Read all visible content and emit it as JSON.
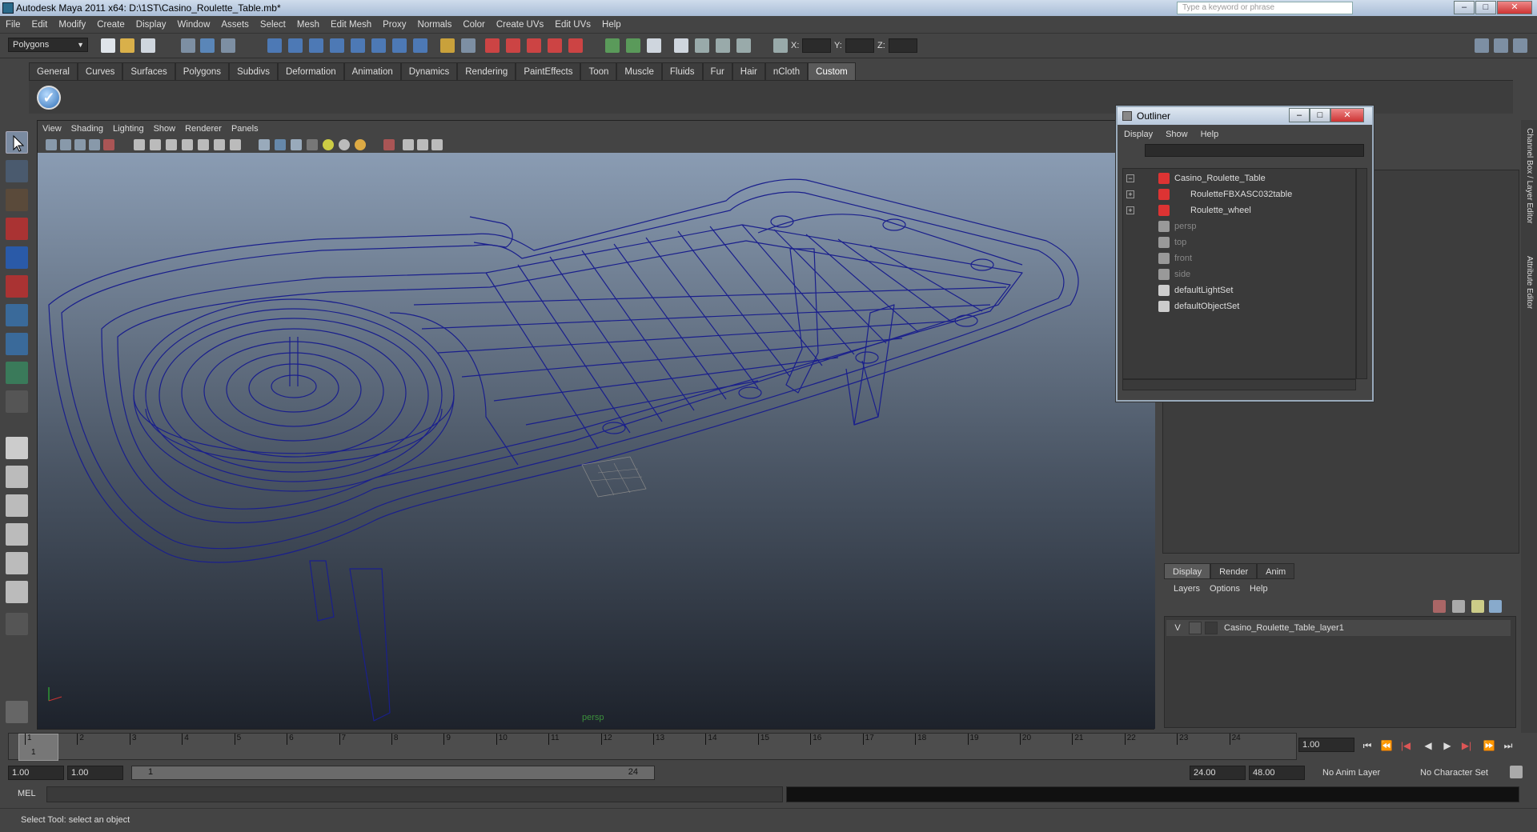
{
  "window": {
    "title": "Autodesk Maya 2011 x64: D:\\1ST\\Casino_Roulette_Table.mb*",
    "search_placeholder": "Type a keyword or phrase",
    "min": "–",
    "max": "□",
    "close": "✕"
  },
  "menu": [
    "File",
    "Edit",
    "Modify",
    "Create",
    "Display",
    "Window",
    "Assets",
    "Select",
    "Mesh",
    "Edit Mesh",
    "Proxy",
    "Normals",
    "Color",
    "Create UVs",
    "Edit UVs",
    "Help"
  ],
  "status": {
    "mode": "Polygons",
    "x_label": "X:",
    "y_label": "Y:",
    "z_label": "Z:"
  },
  "shelf": {
    "tabs": [
      "General",
      "Curves",
      "Surfaces",
      "Polygons",
      "Subdivs",
      "Deformation",
      "Animation",
      "Dynamics",
      "Rendering",
      "PaintEffects",
      "Toon",
      "Muscle",
      "Fluids",
      "Fur",
      "Hair",
      "nCloth",
      "Custom"
    ],
    "active": "Custom",
    "icon": "✓"
  },
  "viewport": {
    "menu": [
      "View",
      "Shading",
      "Lighting",
      "Show",
      "Renderer",
      "Panels"
    ],
    "camera": "persp"
  },
  "outliner": {
    "title": "Outliner",
    "menu": [
      "Display",
      "Show",
      "Help"
    ],
    "items": [
      {
        "label": "Casino_Roulette_Table",
        "expander": "−",
        "dim": false
      },
      {
        "label": "RouletteFBXASC032table",
        "expander": "+",
        "dim": false
      },
      {
        "label": "Roulette_wheel",
        "expander": "+",
        "dim": false
      },
      {
        "label": "persp",
        "expander": "",
        "dim": true
      },
      {
        "label": "top",
        "expander": "",
        "dim": true
      },
      {
        "label": "front",
        "expander": "",
        "dim": true
      },
      {
        "label": "side",
        "expander": "",
        "dim": true
      },
      {
        "label": "defaultLightSet",
        "expander": "",
        "dim": false
      },
      {
        "label": "defaultObjectSet",
        "expander": "",
        "dim": false
      }
    ]
  },
  "layers": {
    "tabs": [
      "Display",
      "Render",
      "Anim"
    ],
    "menu": [
      "Layers",
      "Options",
      "Help"
    ],
    "layer_visible": "V",
    "layer_name": "Casino_Roulette_Table_layer1"
  },
  "side_tabs": [
    "Channel Box / Layer Editor",
    "Attribute Editor"
  ],
  "timeline": {
    "ticks": [
      1,
      2,
      3,
      4,
      5,
      6,
      7,
      8,
      9,
      10,
      11,
      12,
      13,
      14,
      15,
      16,
      17,
      18,
      19,
      20,
      21,
      22,
      23,
      24
    ],
    "current_frame": "1",
    "current_field": "1.00"
  },
  "range": {
    "start": "1.00",
    "start2": "1.00",
    "slider_start": "1",
    "slider_end": "24",
    "end": "24.00",
    "end2": "48.00",
    "anim_layer": "No Anim Layer",
    "char_set": "No Character Set"
  },
  "command": {
    "label": "MEL"
  },
  "help_line": "Select Tool: select an object",
  "colors": {
    "wire": "#1a1f8c",
    "bg_top": "#8a9cb3",
    "bg_bottom": "#1d222b"
  }
}
